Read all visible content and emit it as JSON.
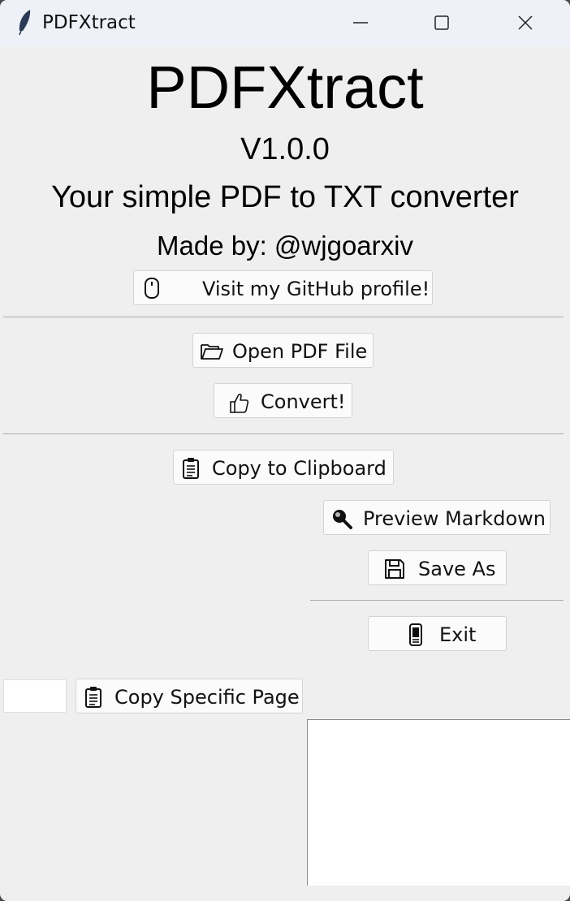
{
  "window": {
    "title": "PDFXtract",
    "app_icon": "feather-icon",
    "controls": [
      "minimize-icon",
      "maximize-icon",
      "close-icon"
    ]
  },
  "header": {
    "title": "PDFXtract",
    "version": "V1.0.0",
    "tagline": "Your simple PDF to TXT converter",
    "author": "Made by: @wjgoarxiv"
  },
  "buttons": {
    "github": {
      "label": "Visit my GitHub profile!",
      "icon": "mouse-icon"
    },
    "open_pdf": {
      "label": "Open PDF File",
      "icon": "folder-open-icon"
    },
    "convert": {
      "label": "Convert!",
      "icon": "thumbs-up-icon"
    },
    "copy_clipboard": {
      "label": "Copy to Clipboard",
      "icon": "clipboard-icon"
    },
    "preview_markdown": {
      "label": "Preview Markdown",
      "icon": "magnifier-icon"
    },
    "save_as": {
      "label": "Save As",
      "icon": "floppy-disk-icon"
    },
    "exit": {
      "label": "Exit",
      "icon": "phone-icon"
    },
    "copy_page": {
      "label": "Copy Specific Page",
      "icon": "clipboard-icon"
    }
  },
  "page_entry": {
    "value": ""
  },
  "output_text": {
    "value": ""
  },
  "colors": {
    "window_bg": "#f0eff0",
    "titlebar_bg": "#eef1f8",
    "button_bg": "#fbfbfc"
  }
}
